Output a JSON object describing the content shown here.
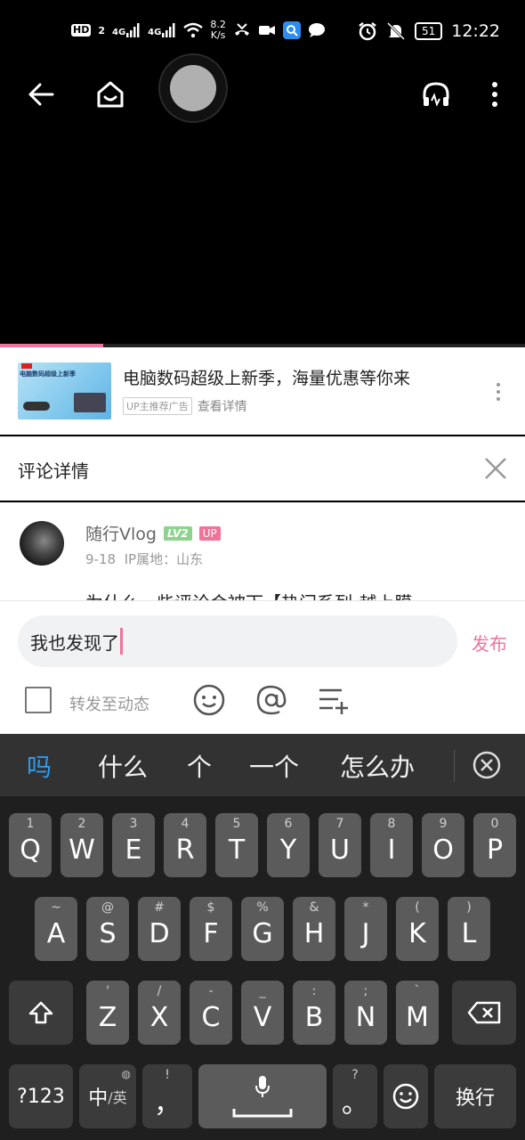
{
  "status_bar": {
    "hd": "HD",
    "sim1": "4G",
    "sim2": "4G",
    "speed_value": "8.2",
    "speed_unit": "K/s",
    "battery": "51",
    "time": "12:22"
  },
  "ad": {
    "thumb_text": "电脑数码超级上新季",
    "title": "电脑数码超级上新季，海量优惠等你来",
    "tag": "UP主推荐广告",
    "detail_link": "查看详情"
  },
  "comment_detail": {
    "title": "评论详情"
  },
  "comment": {
    "user_name": "随行Vlog",
    "level": "LV2",
    "up_badge": "UP",
    "date": "9-18",
    "location": "IP属地：山东",
    "text_preview": "为什么一些评论会被下【热门系列-越上膜"
  },
  "composer": {
    "input_value": "我也发现了",
    "publish_label": "发布",
    "forward_label": "转发至动态"
  },
  "keyboard": {
    "candidates": [
      "吗",
      "什么",
      "个",
      "一个",
      "怎么办"
    ],
    "row1": [
      {
        "main": "Q",
        "sub": "1"
      },
      {
        "main": "W",
        "sub": "2"
      },
      {
        "main": "E",
        "sub": "3"
      },
      {
        "main": "R",
        "sub": "4"
      },
      {
        "main": "T",
        "sub": "5"
      },
      {
        "main": "Y",
        "sub": "6"
      },
      {
        "main": "U",
        "sub": "7"
      },
      {
        "main": "I",
        "sub": "8"
      },
      {
        "main": "O",
        "sub": "9"
      },
      {
        "main": "P",
        "sub": "0"
      }
    ],
    "row2": [
      {
        "main": "A",
        "sub": "~"
      },
      {
        "main": "S",
        "sub": "@"
      },
      {
        "main": "D",
        "sub": "#"
      },
      {
        "main": "F",
        "sub": "$"
      },
      {
        "main": "G",
        "sub": "%"
      },
      {
        "main": "H",
        "sub": "&"
      },
      {
        "main": "J",
        "sub": "*"
      },
      {
        "main": "K",
        "sub": "("
      },
      {
        "main": "L",
        "sub": ")"
      }
    ],
    "row3": [
      {
        "main": "Z",
        "sub": "'"
      },
      {
        "main": "X",
        "sub": "/"
      },
      {
        "main": "C",
        "sub": "-"
      },
      {
        "main": "V",
        "sub": "_"
      },
      {
        "main": "B",
        "sub": ":"
      },
      {
        "main": "N",
        "sub": ";"
      },
      {
        "main": "M",
        "sub": "`"
      }
    ],
    "num_key": "?123",
    "lang_key_main": "中",
    "lang_key_sub": "/英",
    "comma_main": "，",
    "comma_sub": "!",
    "period_main": "。",
    "period_sub": "?",
    "enter_key": "换行"
  }
}
